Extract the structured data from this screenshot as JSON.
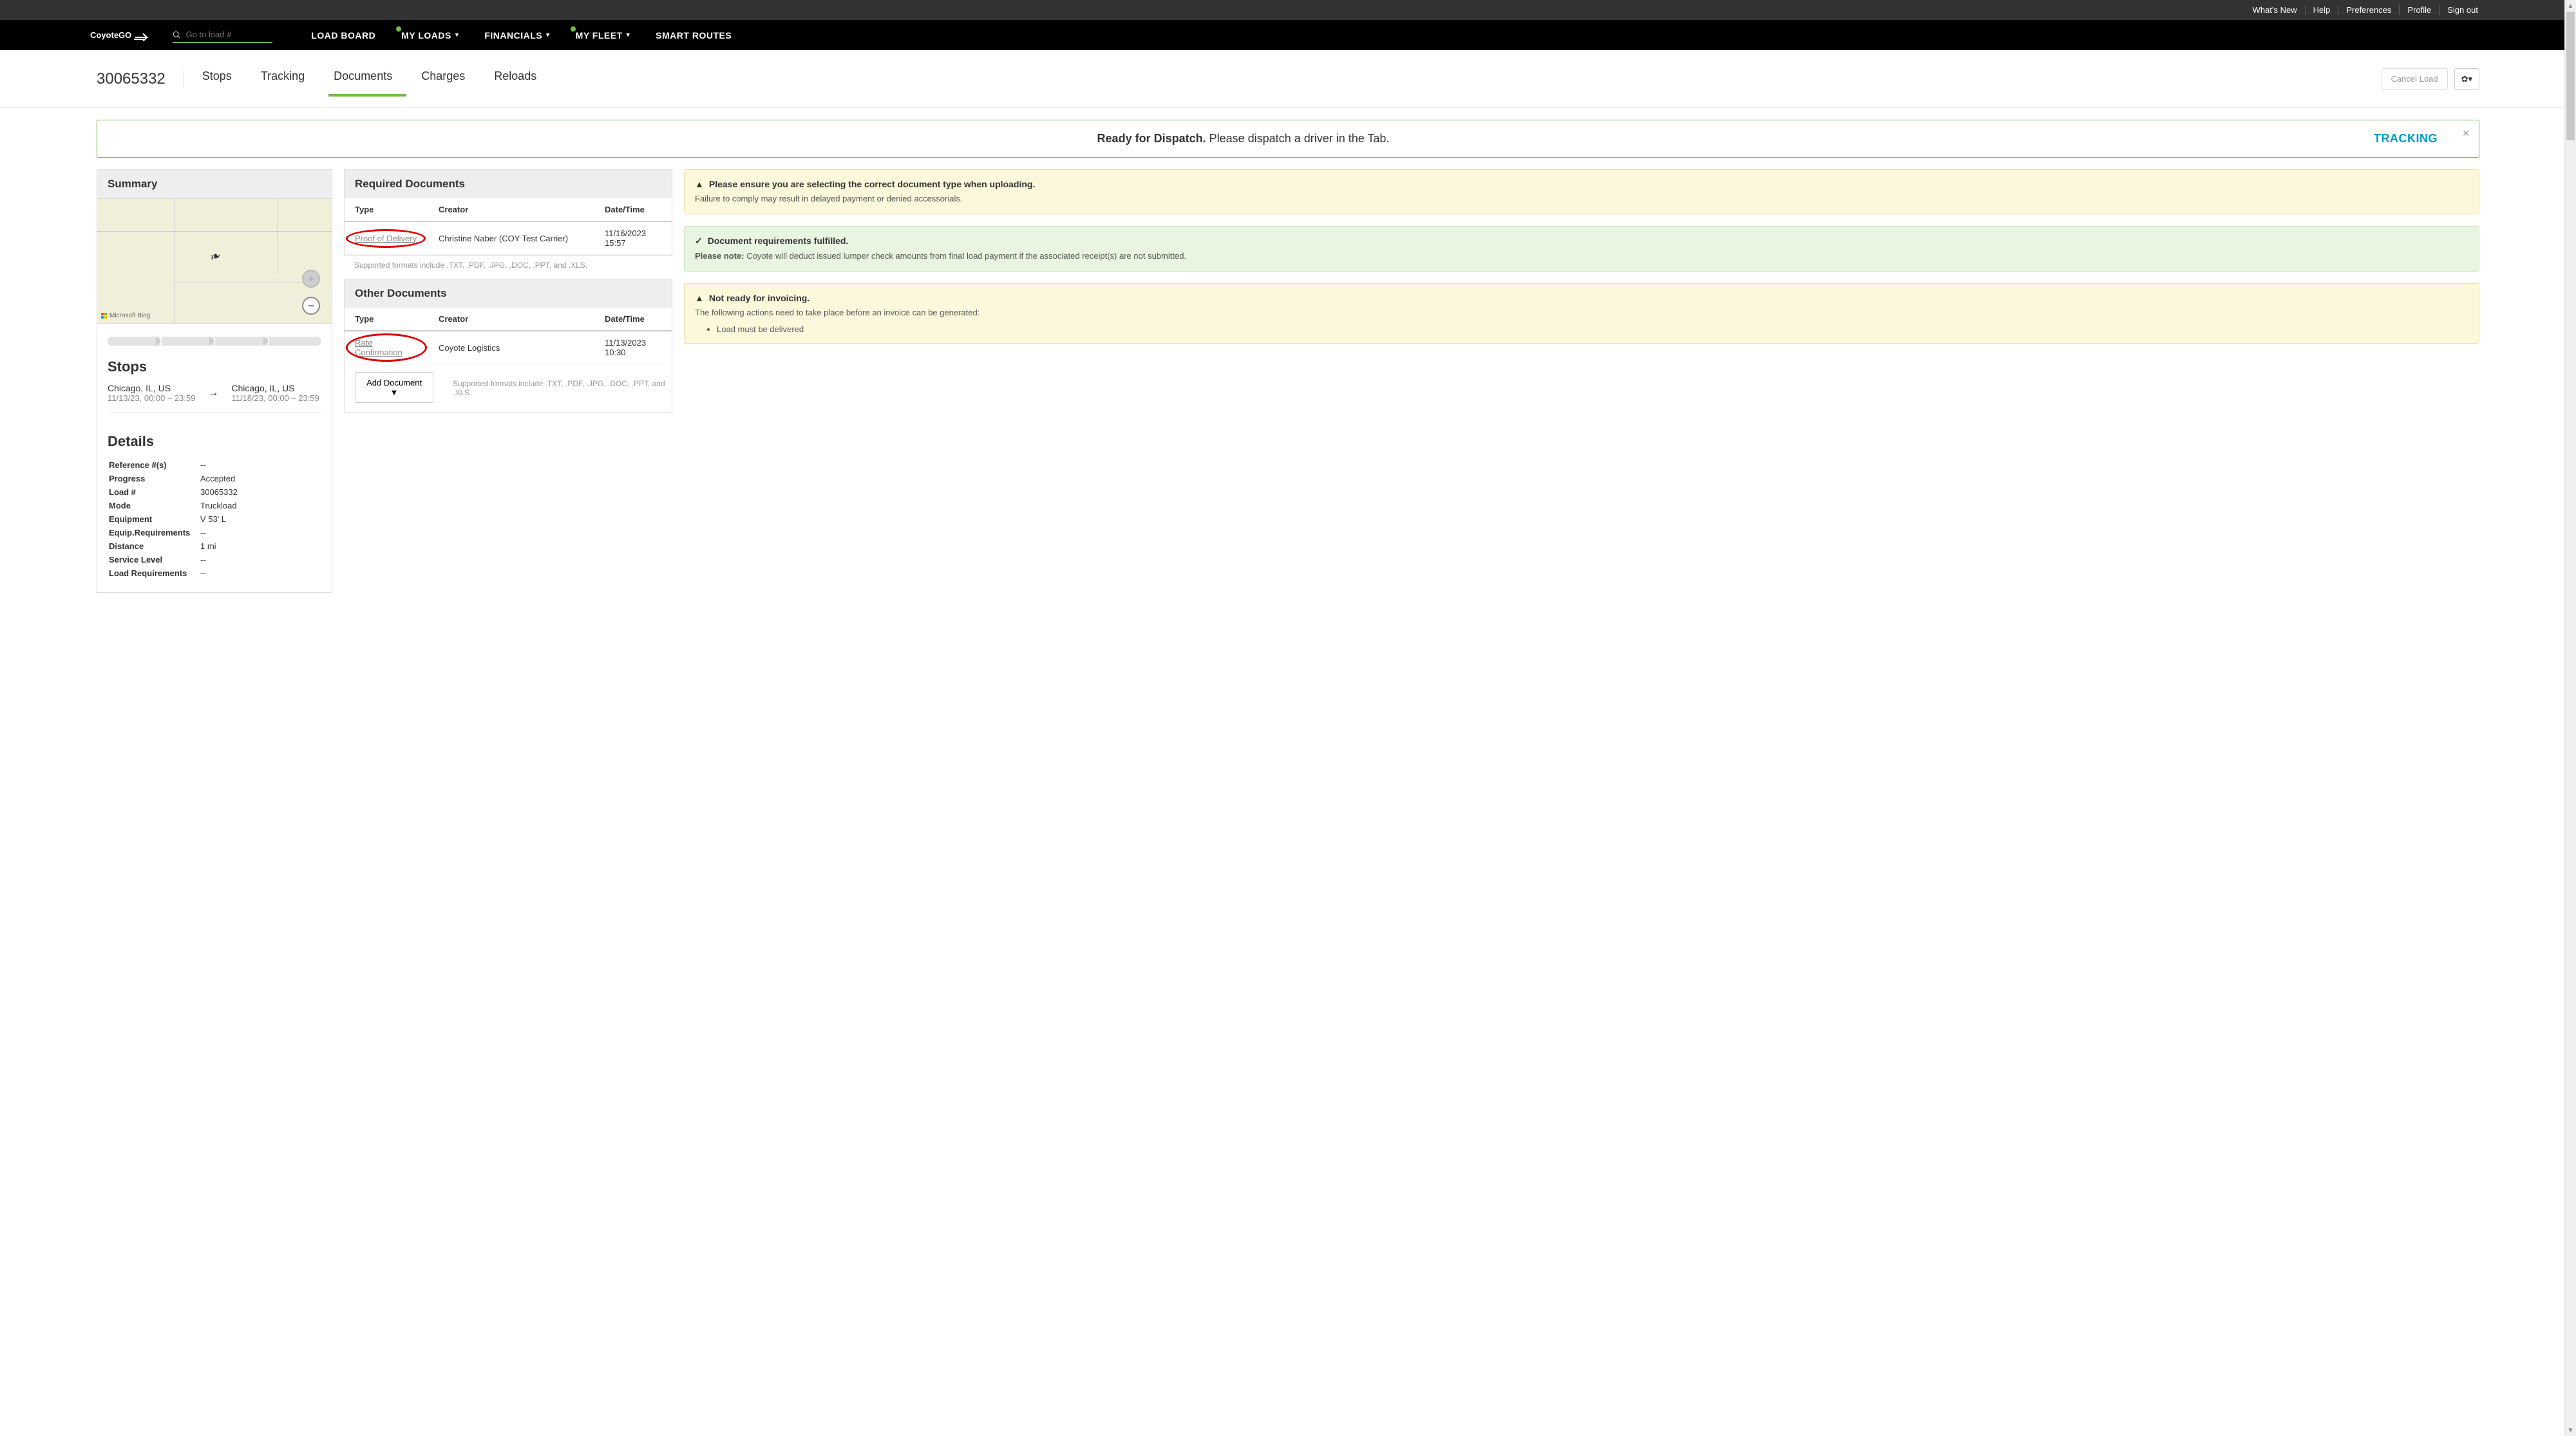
{
  "utility": {
    "whatsNew": "What's New",
    "help": "Help",
    "preferences": "Preferences",
    "profile": "Profile",
    "signOut": "Sign out"
  },
  "logo": "CoyoteGO",
  "search": {
    "placeholder": "Go to load #"
  },
  "nav": {
    "loadBoard": "LOAD BOARD",
    "myLoads": "MY LOADS",
    "financials": "FINANCIALS",
    "myFleet": "MY FLEET",
    "smartRoutes": "SMART ROUTES"
  },
  "page": {
    "loadId": "30065332",
    "tabs": {
      "stops": "Stops",
      "tracking": "Tracking",
      "documents": "Documents",
      "charges": "Charges",
      "reloads": "Reloads"
    },
    "cancel": "Cancel Load"
  },
  "banner": {
    "title": "Ready for Dispatch.",
    "body": "Please dispatch a driver in the Tab.",
    "link": "TRACKING"
  },
  "summary": {
    "title": "Summary",
    "mapCredit": "Microsoft Bing",
    "stopsTitle": "Stops",
    "origin": {
      "loc": "Chicago, IL, US",
      "dt": "11/13/23, 00:00 – 23:59"
    },
    "dest": {
      "loc": "Chicago, IL, US",
      "dt": "11/18/23, 00:00 – 23:59"
    },
    "detailsTitle": "Details",
    "details": {
      "refLabel": "Reference #(s)",
      "refVal": "--",
      "progLabel": "Progress",
      "progVal": "Accepted",
      "loadLabel": "Load #",
      "loadVal": "30065332",
      "modeLabel": "Mode",
      "modeVal": "Truckload",
      "equipLabel": "Equipment",
      "equipVal": "V 53' L",
      "eqReqLabel": "Equip.Requirements",
      "eqReqVal": "--",
      "distLabel": "Distance",
      "distVal": "1 mi",
      "svcLabel": "Service Level",
      "svcVal": "--",
      "loadReqLabel": "Load Requirements",
      "loadReqVal": "--"
    }
  },
  "req": {
    "title": "Required Documents",
    "cols": {
      "type": "Type",
      "creator": "Creator",
      "dt": "Date/Time"
    },
    "row": {
      "type": "Proof of Delivery",
      "creator": "Christine Naber (COY Test Carrier)",
      "dt": "11/16/2023 15:57"
    },
    "hint": "Supported formats include .TXT, .PDF, .JPG, .DOC, .PPT, and .XLS."
  },
  "other": {
    "title": "Other Documents",
    "cols": {
      "type": "Type",
      "creator": "Creator",
      "dt": "Date/Time"
    },
    "row": {
      "type": "Rate Confirmation",
      "creator": "Coyote Logistics",
      "dt": "11/13/2023 10:30"
    },
    "add": "Add Document ▼",
    "hint": "Supported formats include .TXT, .PDF, .JPG, .DOC, .PPT, and .XLS."
  },
  "notices": {
    "n1": {
      "title": "Please ensure you are selecting the correct document type when uploading.",
      "body": "Failure to comply may result in delayed payment or denied accessorials."
    },
    "n2": {
      "title": "Document requirements fulfilled.",
      "bodyBold": "Please note:",
      "body": " Coyote will deduct issued lumper check amounts from final load payment if the associated receipt(s) are not submitted."
    },
    "n3": {
      "title": "Not ready for invoicing.",
      "body": "The following actions need to take place before an invoice can be generated:",
      "item": "Load must be delivered"
    }
  }
}
